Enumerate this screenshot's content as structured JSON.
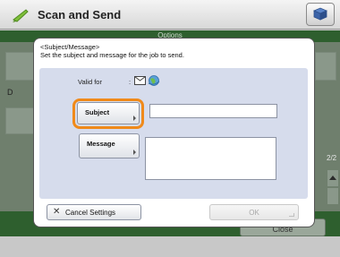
{
  "header": {
    "title": "Scan and Send"
  },
  "background": {
    "options_label": "Options",
    "partial_label": "D",
    "pager": "2/2",
    "close_label": "Close"
  },
  "dialog": {
    "instruction": "<Subject/Message>\nSet the subject and message for the job to send.",
    "valid_for_label": "Valid for",
    "valid_for_colon": ":",
    "valid_for_icons": [
      "email-icon",
      "internet-fax-icon"
    ],
    "subject_button": "Subject",
    "subject_value": "",
    "message_button": "Message",
    "message_value": "",
    "cancel_button": "Cancel Settings",
    "ok_button": "OK"
  },
  "colors": {
    "highlight": "#f08a1a",
    "green_bar": "#2e5f2e",
    "panel": "#d6dcec"
  }
}
